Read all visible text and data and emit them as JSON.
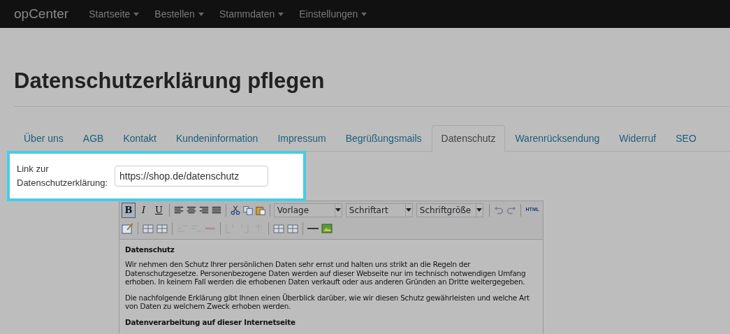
{
  "navbar": {
    "brand": "opCenter",
    "menus": [
      {
        "label": "Startseite"
      },
      {
        "label": "Bestellen"
      },
      {
        "label": "Stammdaten"
      },
      {
        "label": "Einstellungen"
      }
    ]
  },
  "page_title": "Datenschutzerklärung pflegen",
  "tabs": [
    {
      "label": "Über uns",
      "selected": false
    },
    {
      "label": "AGB",
      "selected": false
    },
    {
      "label": "Kontakt",
      "selected": false
    },
    {
      "label": "Kundeninformation",
      "selected": false
    },
    {
      "label": "Impressum",
      "selected": false
    },
    {
      "label": "Begrüßungsmails",
      "selected": false
    },
    {
      "label": "Datenschutz",
      "selected": true
    },
    {
      "label": "Warenrücksendung",
      "selected": false
    },
    {
      "label": "Widerruf",
      "selected": false
    },
    {
      "label": "SEO",
      "selected": false
    }
  ],
  "link_field": {
    "label": "Link zur Datenschutzerklärung:",
    "value": "https://shop.de/datenschutz",
    "highlighted": true
  },
  "editor": {
    "format_buttons": [
      {
        "label": "B",
        "selected": true
      },
      {
        "label": "I",
        "selected": false
      },
      {
        "label": "U",
        "selected": false
      }
    ],
    "dropdowns": [
      {
        "label": "Vorlage"
      },
      {
        "label": "Schriftart"
      },
      {
        "label": "Schriftgröße"
      }
    ],
    "history_disabled": true,
    "source_button": "HTML",
    "content": [
      {
        "kind": "heading",
        "text": "Datenschutz"
      },
      {
        "kind": "paragraph",
        "text": "Wir nehmen den Schutz Ihrer persönlichen Daten sehr ernst und halten uns strikt an die Regeln der Datenschutzgesetze. Personenbezogene Daten werden auf dieser Webseite nur im technisch notwendigen Umfang erhoben. In keinem Fall werden die erhobenen Daten verkauft oder aus anderen Gründen an Dritte weitergegeben."
      },
      {
        "kind": "paragraph",
        "text": "Die nachfolgende Erklärung gibt Ihnen einen Überblick darüber, wie wir diesen Schutz gewährleisten und welche Art von Daten zu welchem Zweck erhoben werden."
      },
      {
        "kind": "heading",
        "text": "Datenverarbeitung auf dieser Internetseite"
      }
    ]
  }
}
